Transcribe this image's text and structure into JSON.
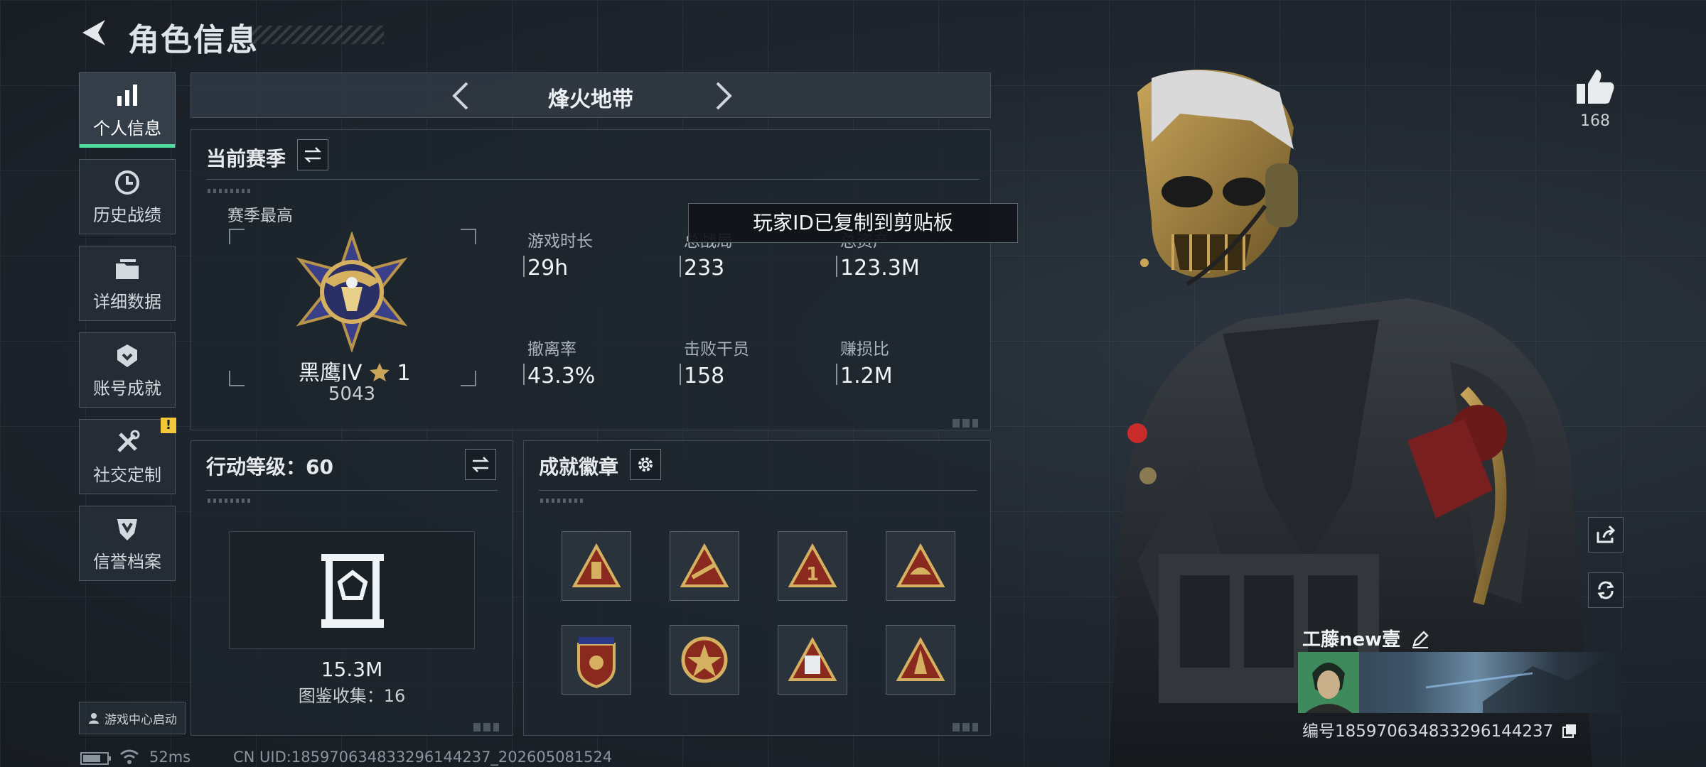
{
  "header": {
    "title": "角色信息"
  },
  "nav": {
    "items": [
      {
        "label": "个人信息",
        "icon": "bar-chart-icon",
        "active": true
      },
      {
        "label": "历史战绩",
        "icon": "clock-icon"
      },
      {
        "label": "详细数据",
        "icon": "folder-icon"
      },
      {
        "label": "账号成就",
        "icon": "achievement-icon"
      },
      {
        "label": "社交定制",
        "icon": "tools-icon",
        "badge": "!"
      },
      {
        "label": "信誉档案",
        "icon": "shield-icon"
      }
    ],
    "launch_label": "游戏中心启动"
  },
  "mode": {
    "title": "烽火地带"
  },
  "season": {
    "title": "当前赛季",
    "best_label": "赛季最高",
    "rank_name": "黑鹰IV",
    "rank_stars": "1",
    "rank_score": "5043",
    "stats": [
      {
        "label": "游戏时长",
        "value": "29h"
      },
      {
        "label": "总战局",
        "value": "233"
      },
      {
        "label": "总资产",
        "value": "123.3M"
      },
      {
        "label": "撤离率",
        "value": "43.3%"
      },
      {
        "label": "击败干员",
        "value": "158"
      },
      {
        "label": "赚损比",
        "value": "1.2M"
      }
    ]
  },
  "toast": {
    "text": "玩家ID已复制到剪贴板"
  },
  "action_level": {
    "title": "行动等级：60",
    "value": "15.3M",
    "collection": "图鉴收集：16"
  },
  "achievements": {
    "title": "成就徽章",
    "badges": [
      "achievement-badge-1",
      "achievement-badge-2",
      "achievement-badge-3",
      "achievement-badge-4",
      "achievement-badge-5",
      "achievement-badge-6",
      "achievement-badge-7",
      "achievement-badge-8"
    ]
  },
  "player": {
    "likes": "168",
    "name": "工藤new壹",
    "id_text": "编号1859706348332961442​37"
  },
  "status_bar": {
    "ping": "52ms",
    "uid": "CN UID:1859706348332961442​37_202605081524"
  },
  "colors": {
    "accent": "#4fe0a0",
    "warn": "#f2c83a",
    "gold": "#b8944a"
  }
}
